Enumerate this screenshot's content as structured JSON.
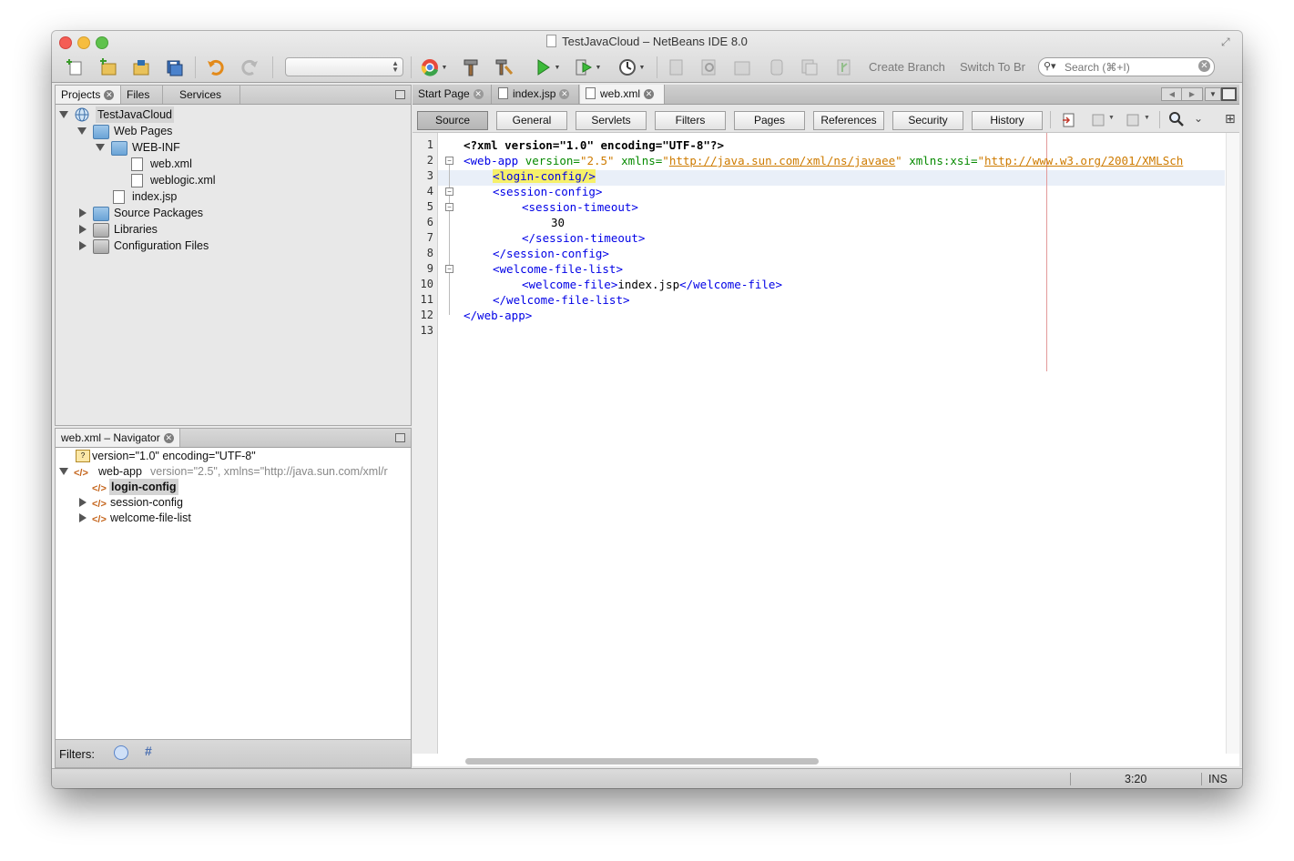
{
  "window": {
    "title": "TestJavaCloud – NetBeans IDE 8.0"
  },
  "toolbar": {
    "create_branch": "Create Branch",
    "switch_to_branch": "Switch To Br",
    "search_placeholder": "Search (⌘+I)"
  },
  "projects_panel": {
    "tabs": [
      {
        "label": "Projects"
      },
      {
        "label": "Files"
      },
      {
        "label": "Services"
      }
    ],
    "tree": [
      {
        "label": "TestJavaCloud",
        "icon": "globe-icon"
      },
      {
        "label": "Web Pages",
        "icon": "folder-icon"
      },
      {
        "label": "WEB-INF",
        "icon": "folder-icon"
      },
      {
        "label": "web.xml",
        "icon": "xml-file-icon"
      },
      {
        "label": "weblogic.xml",
        "icon": "xml-file-icon"
      },
      {
        "label": "index.jsp",
        "icon": "jsp-file-icon"
      },
      {
        "label": "Source Packages",
        "icon": "folder-icon"
      },
      {
        "label": "Libraries",
        "icon": "library-icon"
      },
      {
        "label": "Configuration Files",
        "icon": "folder-icon"
      }
    ]
  },
  "navigator_panel": {
    "title": "web.xml – Navigator",
    "tree": [
      {
        "label": "version=\"1.0\" encoding=\"UTF-8\""
      },
      {
        "label": "web-app",
        "detail": "version=\"2.5\", xmlns=\"http://java.sun.com/xml/r"
      },
      {
        "label": "login-config"
      },
      {
        "label": "session-config"
      },
      {
        "label": "welcome-file-list"
      }
    ],
    "filters_label": "Filters:"
  },
  "editor": {
    "tabs": [
      {
        "label": "Start Page"
      },
      {
        "label": "index.jsp"
      },
      {
        "label": "web.xml"
      }
    ],
    "view_buttons": [
      "Source",
      "General",
      "Servlets",
      "Filters",
      "Pages",
      "References",
      "Security",
      "History"
    ],
    "active_view": "Source",
    "line_numbers": [
      "1",
      "2",
      "3",
      "4",
      "5",
      "6",
      "7",
      "8",
      "9",
      "10",
      "11",
      "12",
      "13"
    ],
    "code": {
      "l1": "<?xml version=\"1.0\" encoding=\"UTF-8\"?>",
      "l2_tag": "<web-app",
      "l2_attr1": " version=",
      "l2_val1": "\"2.5\"",
      "l2_attr2": " xmlns=",
      "l2_q": "\"",
      "l2_url1": "http://java.sun.com/xml/ns/javaee",
      "l2_q2": "\"",
      "l2_attr3": " xmlns:xsi=",
      "l2_q3": "\"",
      "l2_url2": "http://www.w3.org/2001/XMLSch",
      "l3": "<login-config/>",
      "l4": "<session-config>",
      "l5": "<session-timeout>",
      "l6": "30",
      "l7": "</session-timeout>",
      "l8": "</session-config>",
      "l9": "<welcome-file-list>",
      "l10_open": "<welcome-file>",
      "l10_text": "index.jsp",
      "l10_close": "</welcome-file>",
      "l11": "</welcome-file-list>",
      "l12": "</web-app>"
    }
  },
  "statusbar": {
    "position": "3:20",
    "mode": "INS"
  },
  "colors": {
    "tag": "#0000e6",
    "attribute": "#068a00",
    "value": "#ce7b00",
    "current_line": "#e9eff8"
  }
}
